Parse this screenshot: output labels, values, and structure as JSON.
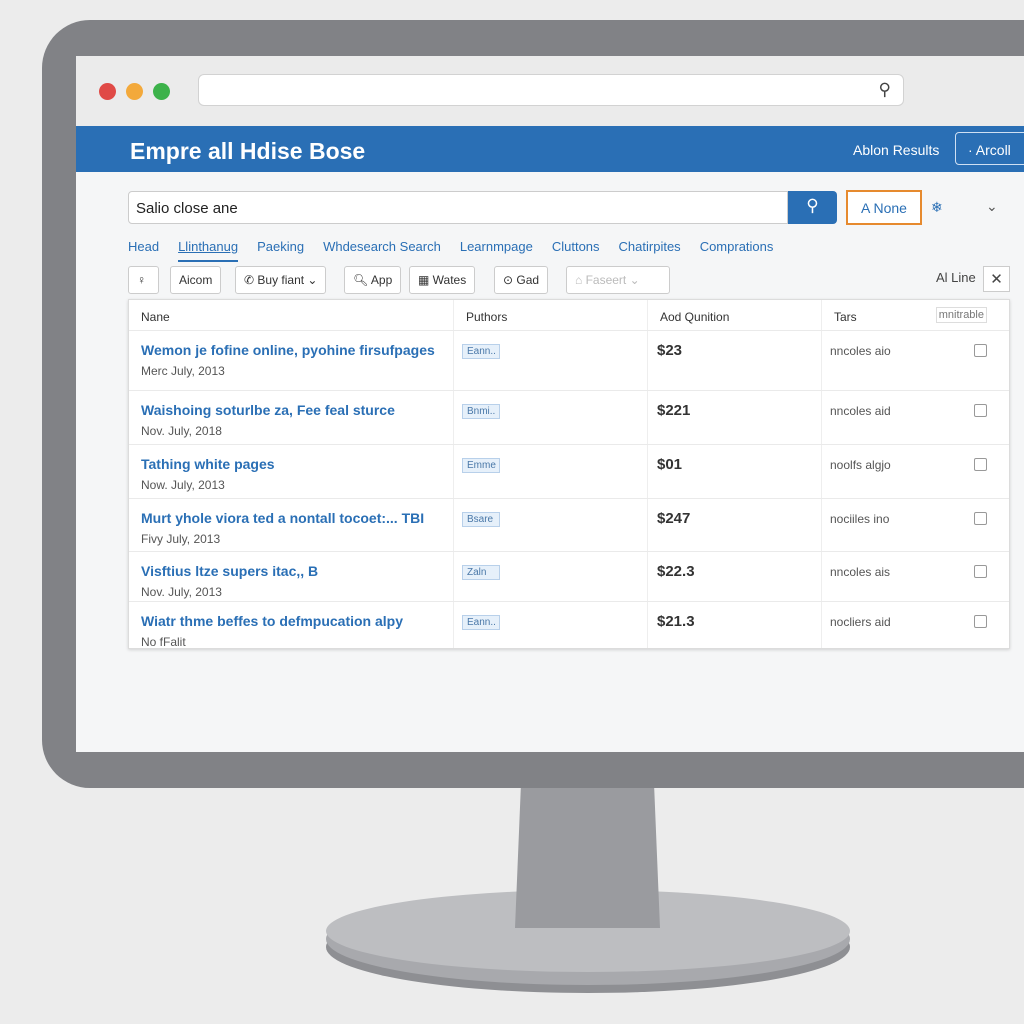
{
  "browser": {
    "url_value": "",
    "search_icon": "search-icon"
  },
  "header": {
    "title": "Empre all Hdise Bose",
    "results_link": "Ablon Results",
    "action_button": "· Arcoll"
  },
  "search": {
    "value": "Salio close ane",
    "filter_button": "A None"
  },
  "tabs": [
    {
      "label": "Head"
    },
    {
      "label": "Llinthanug",
      "active": true
    },
    {
      "label": "Paeking"
    },
    {
      "label": "Whdesearch Search"
    },
    {
      "label": "Learnmpage"
    },
    {
      "label": "Cluttons"
    },
    {
      "label": "Chatirpites"
    },
    {
      "label": "Comprations"
    }
  ],
  "toolbar": {
    "items": [
      {
        "label": "♀"
      },
      {
        "label": "Aicom"
      },
      {
        "label": "✆ Buy fiant ⌄"
      },
      {
        "label": "🔍︎ App"
      },
      {
        "label": "▦ Wates"
      },
      {
        "label": "⊙ Gad"
      },
      {
        "label": "⌂ Faseert ⌄"
      }
    ],
    "right_label": "Al Line",
    "close": "✕"
  },
  "table": {
    "columns": [
      "Nane",
      "Puthors",
      "Aod Qunition",
      "Tars",
      "mnitrable"
    ],
    "rows": [
      {
        "name": "Wemon je fofine online, pyohine firsufpages",
        "date": "Merc July, 2013",
        "author": "Eann..",
        "price": "$23",
        "tars": "nncoles aio"
      },
      {
        "name": "Waishoing soturlbe za, Fee feal sturce",
        "date": "Nov. July, 2018",
        "author": "Bnmi..",
        "price": "$221",
        "tars": "nncoles aid"
      },
      {
        "name": "Tathing white pages",
        "date": "Now. July, 2013",
        "author": "Emme",
        "price": "$01",
        "tars": "noolfs algjo"
      },
      {
        "name": "Murt yhole viora ted a nontall tocoet:... TBI",
        "date": "Fivy July, 2013",
        "author": "Bsare",
        "price": "$247",
        "tars": "nociiles ino"
      },
      {
        "name": "Visftius ltze supers itac,, B",
        "date": "Nov. July, 2013",
        "author": "Zaln",
        "price": "$22.3",
        "tars": "nncoles ais"
      },
      {
        "name": "Wiatr thme beffes to defmpucation alpy",
        "date": "No fFalit",
        "author": "Eann..",
        "price": "$21.3",
        "tars": "nocliers aid"
      }
    ]
  },
  "colors": {
    "brand": "#2a6fb5",
    "accent_border": "#e68a2e"
  }
}
